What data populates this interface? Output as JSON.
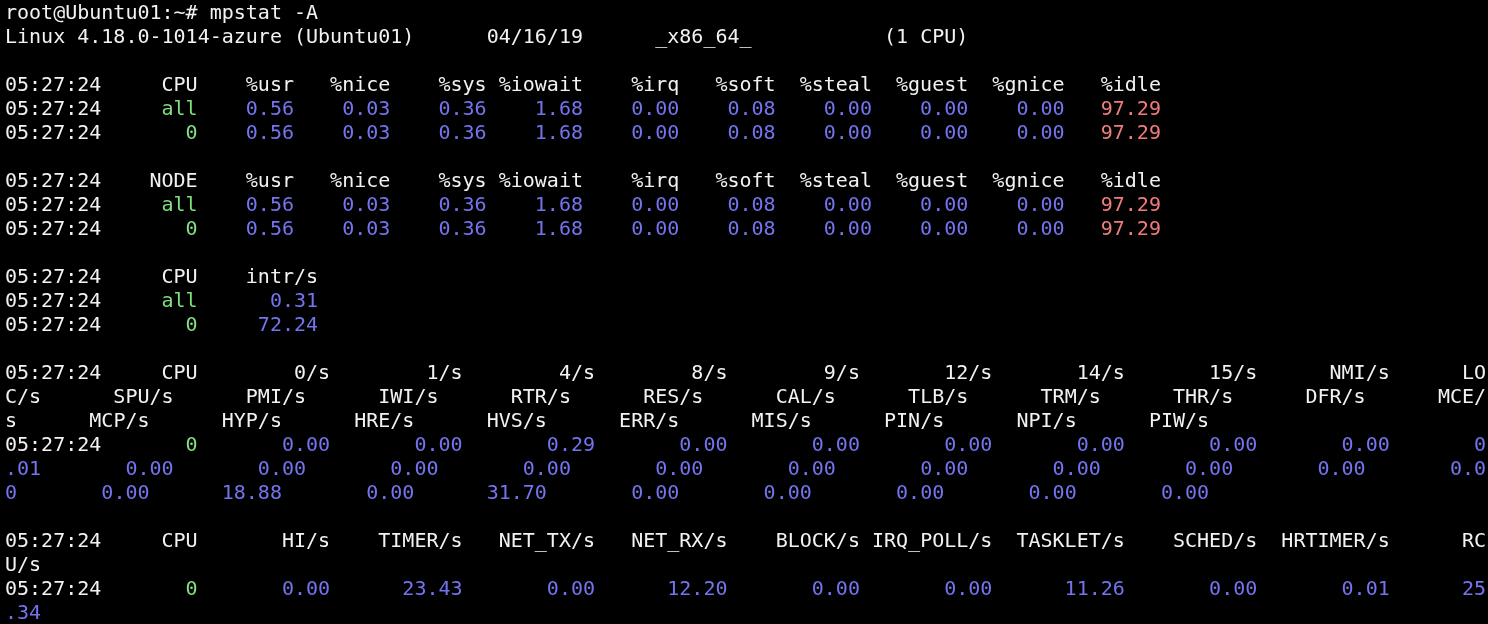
{
  "terminal": {
    "lines": [
      {
        "kind": "text",
        "segments": [
          {
            "kind": "text",
            "text": "root@Ubuntu01:~# mpstat -A"
          }
        ]
      },
      {
        "kind": "text",
        "segments": [
          {
            "kind": "text",
            "text": "Linux 4.18.0-1014-azure (Ubuntu01)"
          },
          {
            "kind": "text",
            "text": "      04/16/19"
          },
          {
            "kind": "text",
            "text": "      _x86_64_"
          },
          {
            "kind": "text",
            "text": "           (1 CPU)"
          }
        ]
      },
      {
        "kind": "blank"
      },
      {
        "kind": "text",
        "segments": [
          {
            "kind": "text",
            "text": "05:27:24"
          },
          {
            "kind": "header",
            "text": "     CPU"
          },
          {
            "kind": "header",
            "text": "    %usr"
          },
          {
            "kind": "header",
            "text": "   %nice"
          },
          {
            "kind": "header",
            "text": "    %sys"
          },
          {
            "kind": "header",
            "text": " %iowait"
          },
          {
            "kind": "header",
            "text": "    %irq"
          },
          {
            "kind": "header",
            "text": "   %soft"
          },
          {
            "kind": "header",
            "text": "  %steal"
          },
          {
            "kind": "header",
            "text": "  %guest"
          },
          {
            "kind": "header",
            "text": "  %gnice"
          },
          {
            "kind": "header",
            "text": "   %idle"
          }
        ]
      },
      {
        "kind": "text",
        "segments": [
          {
            "kind": "text",
            "text": "05:27:24"
          },
          {
            "kind": "cpu",
            "text": "     all"
          },
          {
            "kind": "value",
            "text": "    0.56"
          },
          {
            "kind": "value",
            "text": "    0.03"
          },
          {
            "kind": "value",
            "text": "    0.36"
          },
          {
            "kind": "value",
            "text": "    1.68"
          },
          {
            "kind": "value",
            "text": "    0.00"
          },
          {
            "kind": "value",
            "text": "    0.08"
          },
          {
            "kind": "value",
            "text": "    0.00"
          },
          {
            "kind": "value",
            "text": "    0.00"
          },
          {
            "kind": "value",
            "text": "    0.00"
          },
          {
            "kind": "idle",
            "text": "   97.29"
          }
        ]
      },
      {
        "kind": "text",
        "segments": [
          {
            "kind": "text",
            "text": "05:27:24"
          },
          {
            "kind": "cpu",
            "text": "       0"
          },
          {
            "kind": "value",
            "text": "    0.56"
          },
          {
            "kind": "value",
            "text": "    0.03"
          },
          {
            "kind": "value",
            "text": "    0.36"
          },
          {
            "kind": "value",
            "text": "    1.68"
          },
          {
            "kind": "value",
            "text": "    0.00"
          },
          {
            "kind": "value",
            "text": "    0.08"
          },
          {
            "kind": "value",
            "text": "    0.00"
          },
          {
            "kind": "value",
            "text": "    0.00"
          },
          {
            "kind": "value",
            "text": "    0.00"
          },
          {
            "kind": "idle",
            "text": "   97.29"
          }
        ]
      },
      {
        "kind": "blank"
      },
      {
        "kind": "text",
        "segments": [
          {
            "kind": "text",
            "text": "05:27:24"
          },
          {
            "kind": "header",
            "text": "    NODE"
          },
          {
            "kind": "header",
            "text": "    %usr"
          },
          {
            "kind": "header",
            "text": "   %nice"
          },
          {
            "kind": "header",
            "text": "    %sys"
          },
          {
            "kind": "header",
            "text": " %iowait"
          },
          {
            "kind": "header",
            "text": "    %irq"
          },
          {
            "kind": "header",
            "text": "   %soft"
          },
          {
            "kind": "header",
            "text": "  %steal"
          },
          {
            "kind": "header",
            "text": "  %guest"
          },
          {
            "kind": "header",
            "text": "  %gnice"
          },
          {
            "kind": "header",
            "text": "   %idle"
          }
        ]
      },
      {
        "kind": "text",
        "segments": [
          {
            "kind": "text",
            "text": "05:27:24"
          },
          {
            "kind": "cpu",
            "text": "     all"
          },
          {
            "kind": "value",
            "text": "    0.56"
          },
          {
            "kind": "value",
            "text": "    0.03"
          },
          {
            "kind": "value",
            "text": "    0.36"
          },
          {
            "kind": "value",
            "text": "    1.68"
          },
          {
            "kind": "value",
            "text": "    0.00"
          },
          {
            "kind": "value",
            "text": "    0.08"
          },
          {
            "kind": "value",
            "text": "    0.00"
          },
          {
            "kind": "value",
            "text": "    0.00"
          },
          {
            "kind": "value",
            "text": "    0.00"
          },
          {
            "kind": "idle",
            "text": "   97.29"
          }
        ]
      },
      {
        "kind": "text",
        "segments": [
          {
            "kind": "text",
            "text": "05:27:24"
          },
          {
            "kind": "cpu",
            "text": "       0"
          },
          {
            "kind": "value",
            "text": "    0.56"
          },
          {
            "kind": "value",
            "text": "    0.03"
          },
          {
            "kind": "value",
            "text": "    0.36"
          },
          {
            "kind": "value",
            "text": "    1.68"
          },
          {
            "kind": "value",
            "text": "    0.00"
          },
          {
            "kind": "value",
            "text": "    0.08"
          },
          {
            "kind": "value",
            "text": "    0.00"
          },
          {
            "kind": "value",
            "text": "    0.00"
          },
          {
            "kind": "value",
            "text": "    0.00"
          },
          {
            "kind": "idle",
            "text": "   97.29"
          }
        ]
      },
      {
        "kind": "blank"
      },
      {
        "kind": "text",
        "segments": [
          {
            "kind": "text",
            "text": "05:27:24"
          },
          {
            "kind": "header",
            "text": "     CPU"
          },
          {
            "kind": "header",
            "text": "    intr/s"
          }
        ]
      },
      {
        "kind": "text",
        "segments": [
          {
            "kind": "text",
            "text": "05:27:24"
          },
          {
            "kind": "cpu",
            "text": "     all"
          },
          {
            "kind": "value",
            "text": "      0.31"
          }
        ]
      },
      {
        "kind": "text",
        "segments": [
          {
            "kind": "text",
            "text": "05:27:24"
          },
          {
            "kind": "cpu",
            "text": "       0"
          },
          {
            "kind": "value",
            "text": "     72.24"
          }
        ]
      },
      {
        "kind": "blank"
      },
      {
        "kind": "text",
        "segments": [
          {
            "kind": "text",
            "text": "05:27:24"
          },
          {
            "kind": "header",
            "text": "     CPU"
          },
          {
            "kind": "header",
            "text": "        0/s"
          },
          {
            "kind": "header",
            "text": "        1/s"
          },
          {
            "kind": "header",
            "text": "        4/s"
          },
          {
            "kind": "header",
            "text": "        8/s"
          },
          {
            "kind": "header",
            "text": "        9/s"
          },
          {
            "kind": "header",
            "text": "       12/s"
          },
          {
            "kind": "header",
            "text": "       14/s"
          },
          {
            "kind": "header",
            "text": "       15/s"
          },
          {
            "kind": "header",
            "text": "      NMI/s"
          },
          {
            "kind": "header",
            "text": "      LO"
          }
        ]
      },
      {
        "kind": "text",
        "segments": [
          {
            "kind": "header",
            "text": "C/s"
          },
          {
            "kind": "header",
            "text": "      SPU/s"
          },
          {
            "kind": "header",
            "text": "      PMI/s"
          },
          {
            "kind": "header",
            "text": "      IWI/s"
          },
          {
            "kind": "header",
            "text": "      RTR/s"
          },
          {
            "kind": "header",
            "text": "      RES/s"
          },
          {
            "kind": "header",
            "text": "      CAL/s"
          },
          {
            "kind": "header",
            "text": "      TLB/s"
          },
          {
            "kind": "header",
            "text": "      TRM/s"
          },
          {
            "kind": "header",
            "text": "      THR/s"
          },
          {
            "kind": "header",
            "text": "      DFR/s"
          },
          {
            "kind": "header",
            "text": "      MCE/"
          }
        ]
      },
      {
        "kind": "text",
        "segments": [
          {
            "kind": "header",
            "text": "s"
          },
          {
            "kind": "header",
            "text": "      MCP/s"
          },
          {
            "kind": "header",
            "text": "      HYP/s"
          },
          {
            "kind": "header",
            "text": "      HRE/s"
          },
          {
            "kind": "header",
            "text": "      HVS/s"
          },
          {
            "kind": "header",
            "text": "      ERR/s"
          },
          {
            "kind": "header",
            "text": "      MIS/s"
          },
          {
            "kind": "header",
            "text": "      PIN/s"
          },
          {
            "kind": "header",
            "text": "      NPI/s"
          },
          {
            "kind": "header",
            "text": "      PIW/s"
          }
        ]
      },
      {
        "kind": "text",
        "segments": [
          {
            "kind": "text",
            "text": "05:27:24"
          },
          {
            "kind": "cpu",
            "text": "       0"
          },
          {
            "kind": "value",
            "text": "       0.00"
          },
          {
            "kind": "value",
            "text": "       0.00"
          },
          {
            "kind": "value",
            "text": "       0.29"
          },
          {
            "kind": "value",
            "text": "       0.00"
          },
          {
            "kind": "value",
            "text": "       0.00"
          },
          {
            "kind": "value",
            "text": "       0.00"
          },
          {
            "kind": "value",
            "text": "       0.00"
          },
          {
            "kind": "value",
            "text": "       0.00"
          },
          {
            "kind": "value",
            "text": "       0.00"
          },
          {
            "kind": "value",
            "text": "       0"
          }
        ]
      },
      {
        "kind": "text",
        "segments": [
          {
            "kind": "value",
            "text": ".01"
          },
          {
            "kind": "value",
            "text": "       0.00"
          },
          {
            "kind": "value",
            "text": "       0.00"
          },
          {
            "kind": "value",
            "text": "       0.00"
          },
          {
            "kind": "value",
            "text": "       0.00"
          },
          {
            "kind": "value",
            "text": "       0.00"
          },
          {
            "kind": "value",
            "text": "       0.00"
          },
          {
            "kind": "value",
            "text": "       0.00"
          },
          {
            "kind": "value",
            "text": "       0.00"
          },
          {
            "kind": "value",
            "text": "       0.00"
          },
          {
            "kind": "value",
            "text": "       0.00"
          },
          {
            "kind": "value",
            "text": "       0.0"
          }
        ]
      },
      {
        "kind": "text",
        "segments": [
          {
            "kind": "value",
            "text": "0"
          },
          {
            "kind": "value",
            "text": "       0.00"
          },
          {
            "kind": "value",
            "text": "      18.88"
          },
          {
            "kind": "value",
            "text": "       0.00"
          },
          {
            "kind": "value",
            "text": "      31.70"
          },
          {
            "kind": "value",
            "text": "       0.00"
          },
          {
            "kind": "value",
            "text": "       0.00"
          },
          {
            "kind": "value",
            "text": "       0.00"
          },
          {
            "kind": "value",
            "text": "       0.00"
          },
          {
            "kind": "value",
            "text": "       0.00"
          }
        ]
      },
      {
        "kind": "blank"
      },
      {
        "kind": "text",
        "segments": [
          {
            "kind": "text",
            "text": "05:27:24"
          },
          {
            "kind": "header",
            "text": "     CPU"
          },
          {
            "kind": "header",
            "text": "       HI/s"
          },
          {
            "kind": "header",
            "text": "    TIMER/s"
          },
          {
            "kind": "header",
            "text": "   NET_TX/s"
          },
          {
            "kind": "header",
            "text": "   NET_RX/s"
          },
          {
            "kind": "header",
            "text": "    BLOCK/s"
          },
          {
            "kind": "header",
            "text": " IRQ_POLL/s"
          },
          {
            "kind": "header",
            "text": "  TASKLET/s"
          },
          {
            "kind": "header",
            "text": "    SCHED/s"
          },
          {
            "kind": "header",
            "text": "  HRTIMER/s"
          },
          {
            "kind": "header",
            "text": "      RC"
          }
        ]
      },
      {
        "kind": "text",
        "segments": [
          {
            "kind": "header",
            "text": "U/s"
          }
        ]
      },
      {
        "kind": "text",
        "segments": [
          {
            "kind": "text",
            "text": "05:27:24"
          },
          {
            "kind": "cpu",
            "text": "       0"
          },
          {
            "kind": "value",
            "text": "       0.00"
          },
          {
            "kind": "value",
            "text": "      23.43"
          },
          {
            "kind": "value",
            "text": "       0.00"
          },
          {
            "kind": "value",
            "text": "      12.20"
          },
          {
            "kind": "value",
            "text": "       0.00"
          },
          {
            "kind": "value",
            "text": "       0.00"
          },
          {
            "kind": "value",
            "text": "      11.26"
          },
          {
            "kind": "value",
            "text": "       0.00"
          },
          {
            "kind": "value",
            "text": "       0.01"
          },
          {
            "kind": "value",
            "text": "      25"
          }
        ]
      },
      {
        "kind": "text",
        "segments": [
          {
            "kind": "value",
            "text": ".34"
          }
        ]
      }
    ]
  }
}
